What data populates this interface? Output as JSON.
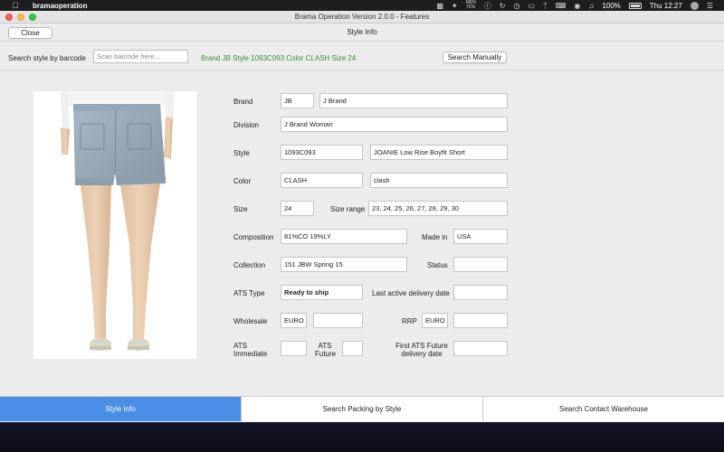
{
  "menubar": {
    "app_name": "bramaoperation",
    "battery_icon_text": "MEN\n76%",
    "battery_percent": "100%",
    "clock": "Thu 12:27"
  },
  "window": {
    "title": "Brama Operation Version 2.0.0 - Features"
  },
  "header": {
    "close_label": "Close",
    "title": "Style Info"
  },
  "search": {
    "label": "Search style by barcode",
    "placeholder": "Scan barcode here...",
    "result": "Brand JB Style 1093C093 Color CLASH Size 24",
    "manual_label": "Search Manually"
  },
  "form": {
    "brand_label": "Brand",
    "brand_code": "JB",
    "brand_name": "J Brand",
    "division_label": "Division",
    "division": "J Brand Woman",
    "style_label": "Style",
    "style_code": "1093C093",
    "style_name": "JOANIE Low Rise Boyfit Short",
    "color_label": "Color",
    "color_code": "CLASH",
    "color_name": "clash",
    "size_label": "Size",
    "size": "24",
    "size_range_label": "Size range",
    "size_range": "23, 24, 25, 26, 27, 28, 29, 30",
    "composition_label": "Composition",
    "composition": "81%CO 19%LY",
    "made_in_label": "Made in",
    "made_in": "USA",
    "collection_label": "Collection",
    "collection": "151 JBW Spring 15",
    "status_label": "Status",
    "status": "",
    "ats_type_label": "ATS Type",
    "ats_type": "Ready to ship",
    "last_delivery_label": "Last active delivery date",
    "last_delivery": "",
    "wholesale_label": "Wholesale",
    "wholesale_currency": "EURO",
    "wholesale_value": "",
    "rrp_label": "RRP",
    "rrp_currency": "EURO",
    "rrp_value": "",
    "ats_immediate_label_1": "ATS",
    "ats_immediate_label_2": "Immediate",
    "ats_immediate": "",
    "ats_future_label_1": "ATS",
    "ats_future_label_2": "Future",
    "ats_future": "",
    "first_future_label_1": "First ATS Future",
    "first_future_label_2": "delivery date",
    "first_future": ""
  },
  "tabs": [
    {
      "label": "Style Info"
    },
    {
      "label": "Search Packing by Style"
    },
    {
      "label": "Search Contact Warehouse"
    }
  ],
  "colors": {
    "active_tab": "#4a8ee8",
    "search_result": "#3d8a3d"
  }
}
